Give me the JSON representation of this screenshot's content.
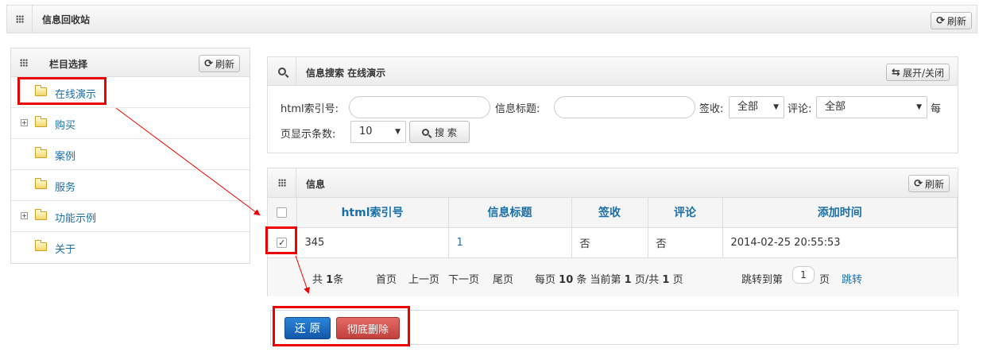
{
  "header": {
    "title": "信息回收站",
    "refresh_label": "刷新"
  },
  "sidebar": {
    "title": "栏目选择",
    "refresh_label": "刷新",
    "items": [
      {
        "label": "在线演示",
        "expandable": false
      },
      {
        "label": "购买",
        "expandable": true
      },
      {
        "label": "案例",
        "expandable": false
      },
      {
        "label": "服务",
        "expandable": false
      },
      {
        "label": "功能示例",
        "expandable": true
      },
      {
        "label": "关于",
        "expandable": false
      }
    ]
  },
  "search": {
    "title": "信息搜索 在线演示",
    "toggle_label": "展开/关闭",
    "html_index_label": "html索引号:",
    "html_index_value": "",
    "info_title_label": "信息标题:",
    "info_title_value": "",
    "sign_label": "签收:",
    "sign_value": "全部",
    "comment_label": "评论:",
    "comment_value": "全部",
    "per_page_label_1": "每",
    "per_page_label_2": "页显示条数:",
    "per_page_value": "10",
    "search_button": "搜 索"
  },
  "info_table": {
    "title": "信息",
    "refresh_label": "刷新",
    "columns": [
      "html索引号",
      "信息标题",
      "签收",
      "评论",
      "添加时间"
    ],
    "rows": [
      {
        "checked": true,
        "html_index": "345",
        "info_title": "1",
        "signed": "否",
        "comment": "否",
        "added_time": "2014-02-25 20:55:53"
      }
    ],
    "pager": {
      "total_prefix": "共",
      "total": "1",
      "total_suffix": "条",
      "first": "首页",
      "prev": "上一页",
      "next": "下一页",
      "last": "尾页",
      "per_page_prefix": "每页",
      "per_page": "10",
      "per_page_mid": "条 当前第",
      "current_page": "1",
      "page_of": "页/共",
      "total_pages": "1",
      "page_suffix": "页",
      "jump_prefix": "跳转到第",
      "jump_value": "1",
      "jump_suffix": "页",
      "jump_button": "跳转"
    }
  },
  "actions": {
    "restore_label": "还 原",
    "delete_label": "彻底删除"
  },
  "colors": {
    "accent_blue": "#1a6fa8",
    "restore_blue": "#1e6fc4",
    "delete_red": "#cf4f4b",
    "annotation_red": "#ee0000"
  }
}
